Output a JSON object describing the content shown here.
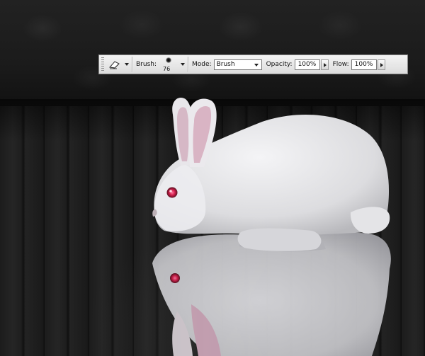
{
  "options_bar": {
    "tool_icon": "eraser-icon",
    "brush_label": "Brush:",
    "brush_size": "76",
    "mode_label": "Mode:",
    "mode_value": "Brush",
    "opacity_label": "Opacity:",
    "opacity_value": "100%",
    "flow_label": "Flow:",
    "flow_value": "100%"
  },
  "canvas": {
    "subject": "white-rabbit-with-reflection",
    "colors": {
      "wall": "#1e1e1e",
      "floor": "#1a1a1a",
      "fur": "#e6e6e8",
      "ear_inner": "#d9b9c6",
      "eye": "#e0305a"
    }
  }
}
